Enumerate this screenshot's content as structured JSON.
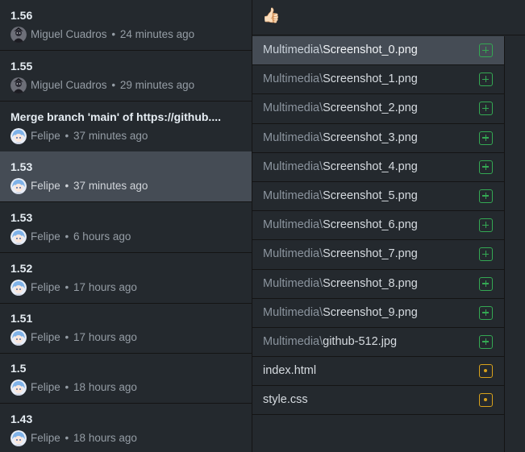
{
  "commits": [
    {
      "summary": "1.56",
      "author": "Miguel Cuadros",
      "time": "24 minutes ago",
      "avatar": "dark-avatar"
    },
    {
      "summary": "1.55",
      "author": "Miguel Cuadros",
      "time": "29 minutes ago",
      "avatar": "dark-avatar"
    },
    {
      "summary": "Merge branch 'main' of https://github....",
      "author": "Felipe",
      "time": "37 minutes ago",
      "avatar": "anime-avatar"
    },
    {
      "summary": "1.53",
      "author": "Felipe",
      "time": "37 minutes ago",
      "avatar": "anime-avatar",
      "selected": true
    },
    {
      "summary": "1.53",
      "author": "Felipe",
      "time": "6 hours ago",
      "avatar": "anime-avatar"
    },
    {
      "summary": "1.52",
      "author": "Felipe",
      "time": "17 hours ago",
      "avatar": "anime-avatar"
    },
    {
      "summary": "1.51",
      "author": "Felipe",
      "time": "17 hours ago",
      "avatar": "anime-avatar"
    },
    {
      "summary": "1.5",
      "author": "Felipe",
      "time": "18 hours ago",
      "avatar": "anime-avatar"
    },
    {
      "summary": "1.43",
      "author": "Felipe",
      "time": "18 hours ago",
      "avatar": "anime-avatar"
    }
  ],
  "separator": "•",
  "header": {
    "emoji": "👍🏻"
  },
  "files": [
    {
      "dir": "Multimedia\\",
      "name": "Screenshot_0.png",
      "status": "added",
      "selected": true
    },
    {
      "dir": "Multimedia\\",
      "name": "Screenshot_1.png",
      "status": "added"
    },
    {
      "dir": "Multimedia\\",
      "name": "Screenshot_2.png",
      "status": "added"
    },
    {
      "dir": "Multimedia\\",
      "name": "Screenshot_3.png",
      "status": "added"
    },
    {
      "dir": "Multimedia\\",
      "name": "Screenshot_4.png",
      "status": "added"
    },
    {
      "dir": "Multimedia\\",
      "name": "Screenshot_5.png",
      "status": "added"
    },
    {
      "dir": "Multimedia\\",
      "name": "Screenshot_6.png",
      "status": "added"
    },
    {
      "dir": "Multimedia\\",
      "name": "Screenshot_7.png",
      "status": "added"
    },
    {
      "dir": "Multimedia\\",
      "name": "Screenshot_8.png",
      "status": "added"
    },
    {
      "dir": "Multimedia\\",
      "name": "Screenshot_9.png",
      "status": "added"
    },
    {
      "dir": "Multimedia\\",
      "name": "github-512.jpg",
      "status": "added"
    },
    {
      "dir": "",
      "name": "index.html",
      "status": "modified"
    },
    {
      "dir": "",
      "name": "style.css",
      "status": "modified"
    }
  ],
  "colors": {
    "added": "#34a853",
    "modified": "#d9a21b",
    "selected_bg": "#454c55",
    "background": "#24292e"
  }
}
